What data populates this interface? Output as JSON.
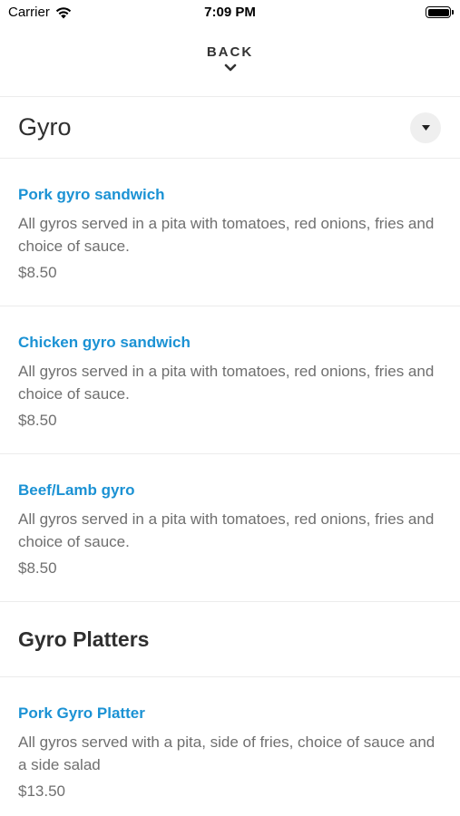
{
  "status_bar": {
    "carrier": "Carrier",
    "time": "7:09 PM"
  },
  "nav": {
    "back_label": "BACK"
  },
  "sections": [
    {
      "title": "Gyro",
      "items": [
        {
          "name": "Pork gyro sandwich",
          "description": "All gyros served in a pita with tomatoes, red onions, fries and choice of sauce.",
          "price": "$8.50"
        },
        {
          "name": "Chicken gyro sandwich",
          "description": "All gyros served in a pita with tomatoes, red onions, fries and choice of sauce.",
          "price": "$8.50"
        },
        {
          "name": "Beef/Lamb gyro",
          "description": "All gyros served in a pita with tomatoes, red onions, fries and choice of sauce.",
          "price": "$8.50"
        }
      ]
    },
    {
      "title": "Gyro Platters",
      "items": [
        {
          "name": "Pork Gyro Platter",
          "description": "All gyros served with a pita, side of fries, choice of sauce and a side salad",
          "price": "$13.50"
        }
      ]
    }
  ],
  "colors": {
    "item_name": "#1b92d4",
    "text_muted": "#6f6f6f",
    "divider": "#ececec"
  },
  "icons": {
    "wifi": "wifi-icon",
    "battery": "battery-icon",
    "back": "chevron-down-icon",
    "dropdown": "caret-down-icon"
  }
}
